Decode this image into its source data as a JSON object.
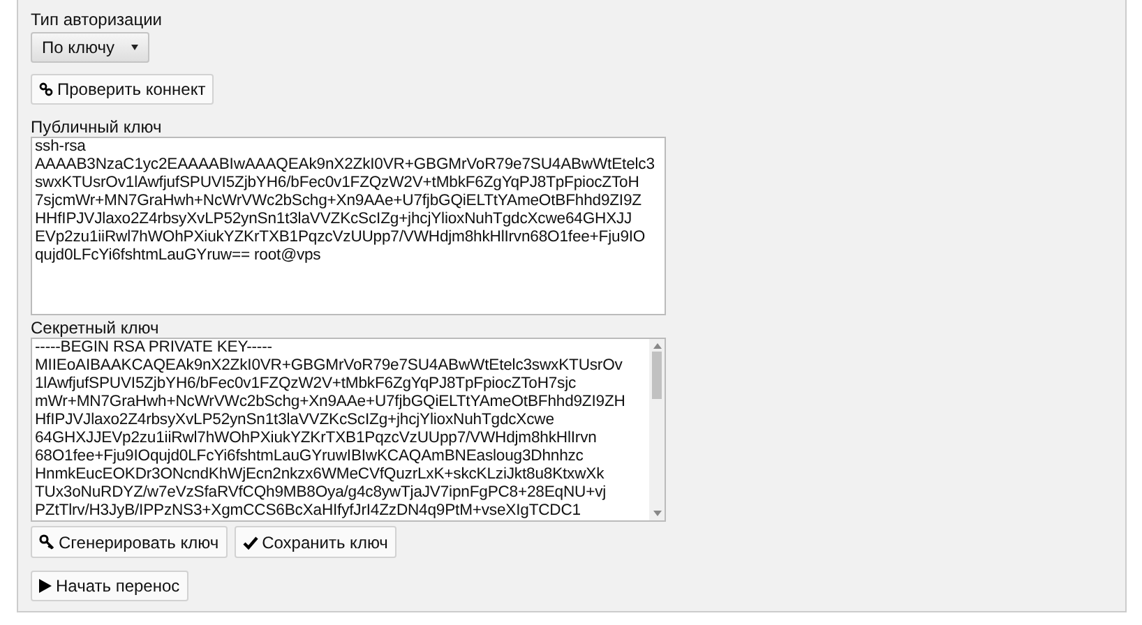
{
  "auth_type": {
    "label": "Тип авторизации",
    "value": "По ключу"
  },
  "check_button": {
    "label": "Проверить коннект"
  },
  "public_key": {
    "label": "Публичный ключ",
    "lines": [
      "ssh-rsa",
      "AAAAB3NzaC1yc2EAAAABIwAAAQEAk9nX2ZkI0VR+GBGMrVoR79e7SU4ABwWtEtelc3",
      "swxKTUsrOv1lAwfjufSPUVI5ZjbYH6/bFec0v1FZQzW2V+tMbkF6ZgYqPJ8TpFpiocZToH",
      "7sjcmWr+MN7GraHwh+NcWrVWc2bSchg+Xn9AAe+U7fjbGQiELTtYAmeOtBFhhd9ZI9Z",
      "HHfIPJVJlaxo2Z4rbsyXvLP52ynSn1t3laVVZKcScIZg+jhcjYlioxNuhTgdcXcwe64GHXJJ",
      "EVp2zu1iiRwl7hWOhPXiukYZKrTXB1PqzcVzUUpp7/VWHdjm8hkHlIrvn68O1fee+Fju9IO",
      "qujd0LFcYi6fshtmLauGYruw== root@vps"
    ]
  },
  "secret_key": {
    "label": "Секретный ключ",
    "lines": [
      "-----BEGIN RSA PRIVATE KEY-----",
      "MIIEoAIBAAKCAQEAk9nX2ZkI0VR+GBGMrVoR79e7SU4ABwWtEtelc3swxKTUsrOv",
      "1lAwfjufSPUVI5ZjbYH6/bFec0v1FZQzW2V+tMbkF6ZgYqPJ8TpFpiocZToH7sjc",
      "mWr+MN7GraHwh+NcWrVWc2bSchg+Xn9AAe+U7fjbGQiELTtYAmeOtBFhhd9ZI9ZH",
      "HfIPJVJlaxo2Z4rbsyXvLP52ynSn1t3laVVZKcScIZg+jhcjYlioxNuhTgdcXcwe",
      "64GHXJJEVp2zu1iiRwl7hWOhPXiukYZKrTXB1PqzcVzUUpp7/VWHdjm8hkHlIrvn",
      "68O1fee+Fju9IOqujd0LFcYi6fshtmLauGYruwIBIwKCAQAmBNEasloug3Dhnhzc",
      "HnmkEucEOKDr3ONcndKhWjEcn2nkzx6WMeCVfQuzrLxK+skcKLziJkt8u8KtxwXk",
      "TUx3oNuRDYZ/w7eVzSfaRVfCQh9MB8Oya/g4c8ywTjaJV7ipnFgPC8+28EqNU+vj",
      "PZtTlrv/H3JyB/IPPzNS3+XgmCCS6BcXaHIfyfJrI4ZzDN4q9PtM+vseXIgTCDC1"
    ]
  },
  "key_buttons": [
    {
      "kind": "key",
      "label": "Сгенерировать ключ"
    },
    {
      "kind": "check",
      "label": "Сохранить ключ"
    }
  ],
  "start_button": {
    "label": "Начать перенос"
  }
}
